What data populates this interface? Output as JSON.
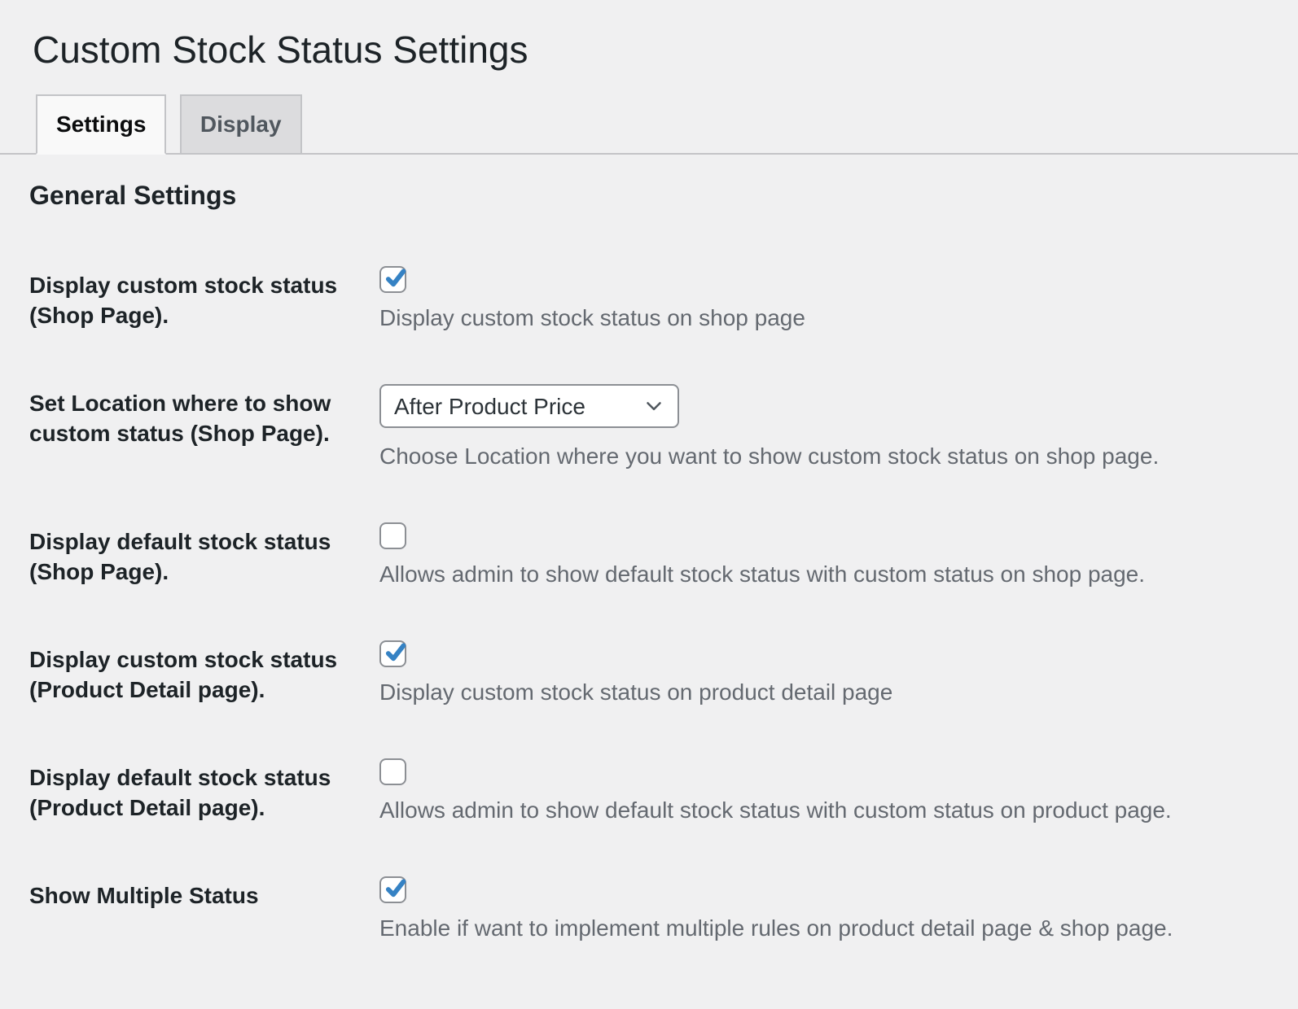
{
  "page": {
    "title": "Custom Stock Status Settings"
  },
  "tabs": [
    {
      "label": "Settings",
      "active": true
    },
    {
      "label": "Display",
      "active": false
    }
  ],
  "section": {
    "heading": "General Settings"
  },
  "rows": [
    {
      "label": "Display custom stock status (Shop Page).",
      "control": {
        "type": "checkbox",
        "checked": true
      },
      "description": "Display custom stock status on shop page"
    },
    {
      "label": "Set Location where to show custom status (Shop Page).",
      "control": {
        "type": "select",
        "value": "After Product Price"
      },
      "description": "Choose Location where you want to show custom stock status on shop page."
    },
    {
      "label": "Display default stock status (Shop Page).",
      "control": {
        "type": "checkbox",
        "checked": false
      },
      "description": "Allows admin to show default stock status with custom status on shop page."
    },
    {
      "label": "Display custom stock status (Product Detail page).",
      "control": {
        "type": "checkbox",
        "checked": true
      },
      "description": "Display custom stock status on product detail page"
    },
    {
      "label": "Display default stock status (Product Detail page).",
      "control": {
        "type": "checkbox",
        "checked": false
      },
      "description": "Allows admin to show default stock status with custom status on product page."
    },
    {
      "label": "Show Multiple Status",
      "control": {
        "type": "checkbox",
        "checked": true
      },
      "description": "Enable if want to implement multiple rules on product detail page & shop page."
    }
  ],
  "colors": {
    "page_background": "#f0f0f1",
    "tab_active_background": "#f9f9f9",
    "tab_inactive_background": "#dcdcde",
    "tab_border": "#c3c4c7",
    "input_border": "#8c8f94",
    "check_accent": "#3582c4",
    "heading_text": "#1d2327",
    "description_text": "#646970"
  }
}
